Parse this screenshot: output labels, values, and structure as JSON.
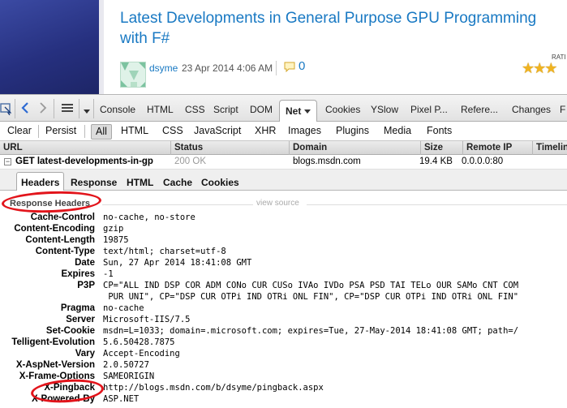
{
  "blog": {
    "title": "Latest Developments in General Purpose GPU Programming with F#",
    "author": "dsyme",
    "date": "23 Apr 2014 4:06 AM",
    "comment_count": "0",
    "rating_label": "RATI",
    "stars": "★★★"
  },
  "firebug": {
    "toolbar_tabs": [
      "Console",
      "HTML",
      "CSS",
      "Script",
      "DOM",
      "Net",
      "Cookies",
      "YSlow",
      "Pixel P...",
      "Refere...",
      "Changes",
      "F"
    ],
    "active_tab": "Net",
    "filters": [
      "Clear",
      "Persist",
      "All",
      "HTML",
      "CSS",
      "JavaScript",
      "XHR",
      "Images",
      "Plugins",
      "Media",
      "Fonts"
    ],
    "active_filter": "All",
    "columns": [
      "URL",
      "Status",
      "Domain",
      "Size",
      "Remote IP",
      "Timeline"
    ],
    "request": {
      "url": "GET latest-developments-in-gp",
      "status": "200 OK",
      "domain": "blogs.msdn.com",
      "size": "19.4 KB",
      "remote_ip": "0.0.0.0:80"
    },
    "detail_tabs": [
      "Headers",
      "Response",
      "HTML",
      "Cache",
      "Cookies"
    ],
    "active_detail_tab": "Headers",
    "section_label": "Response Headers",
    "view_source": "view source",
    "headers": [
      {
        "name": "Cache-Control",
        "value": "no-cache, no-store"
      },
      {
        "name": "Content-Encoding",
        "value": "gzip"
      },
      {
        "name": "Content-Length",
        "value": "19875"
      },
      {
        "name": "Content-Type",
        "value": "text/html; charset=utf-8"
      },
      {
        "name": "Date",
        "value": "Sun, 27 Apr 2014 18:41:08 GMT"
      },
      {
        "name": "Expires",
        "value": "-1"
      },
      {
        "name": "P3P",
        "value": "CP=\"ALL IND DSP COR ADM CONo CUR CUSo IVAo IVDo PSA PSD TAI TELo OUR SAMo CNT COM\n PUR UNI\", CP=\"DSP CUR OTPi IND OTRi ONL FIN\", CP=\"DSP CUR OTPi IND OTRi ONL FIN\""
      },
      {
        "name": "Pragma",
        "value": "no-cache"
      },
      {
        "name": "Server",
        "value": "Microsoft-IIS/7.5"
      },
      {
        "name": "Set-Cookie",
        "value": "msdn=L=1033; domain=.microsoft.com; expires=Tue, 27-May-2014 18:41:08 GMT; path=/"
      },
      {
        "name": "Telligent-Evolution",
        "value": "5.6.50428.7875"
      },
      {
        "name": "Vary",
        "value": "Accept-Encoding"
      },
      {
        "name": "X-AspNet-Version",
        "value": "2.0.50727"
      },
      {
        "name": "X-Frame-Options",
        "value": "SAMEORIGIN"
      },
      {
        "name": "X-Pingback",
        "value": "http://blogs.msdn.com/b/dsyme/pingback.aspx"
      },
      {
        "name": "X-Powered-By",
        "value": "ASP.NET"
      }
    ]
  },
  "colors": {
    "link": "#1979c3",
    "annotation": "#e2141b",
    "star": "#f0b321"
  }
}
